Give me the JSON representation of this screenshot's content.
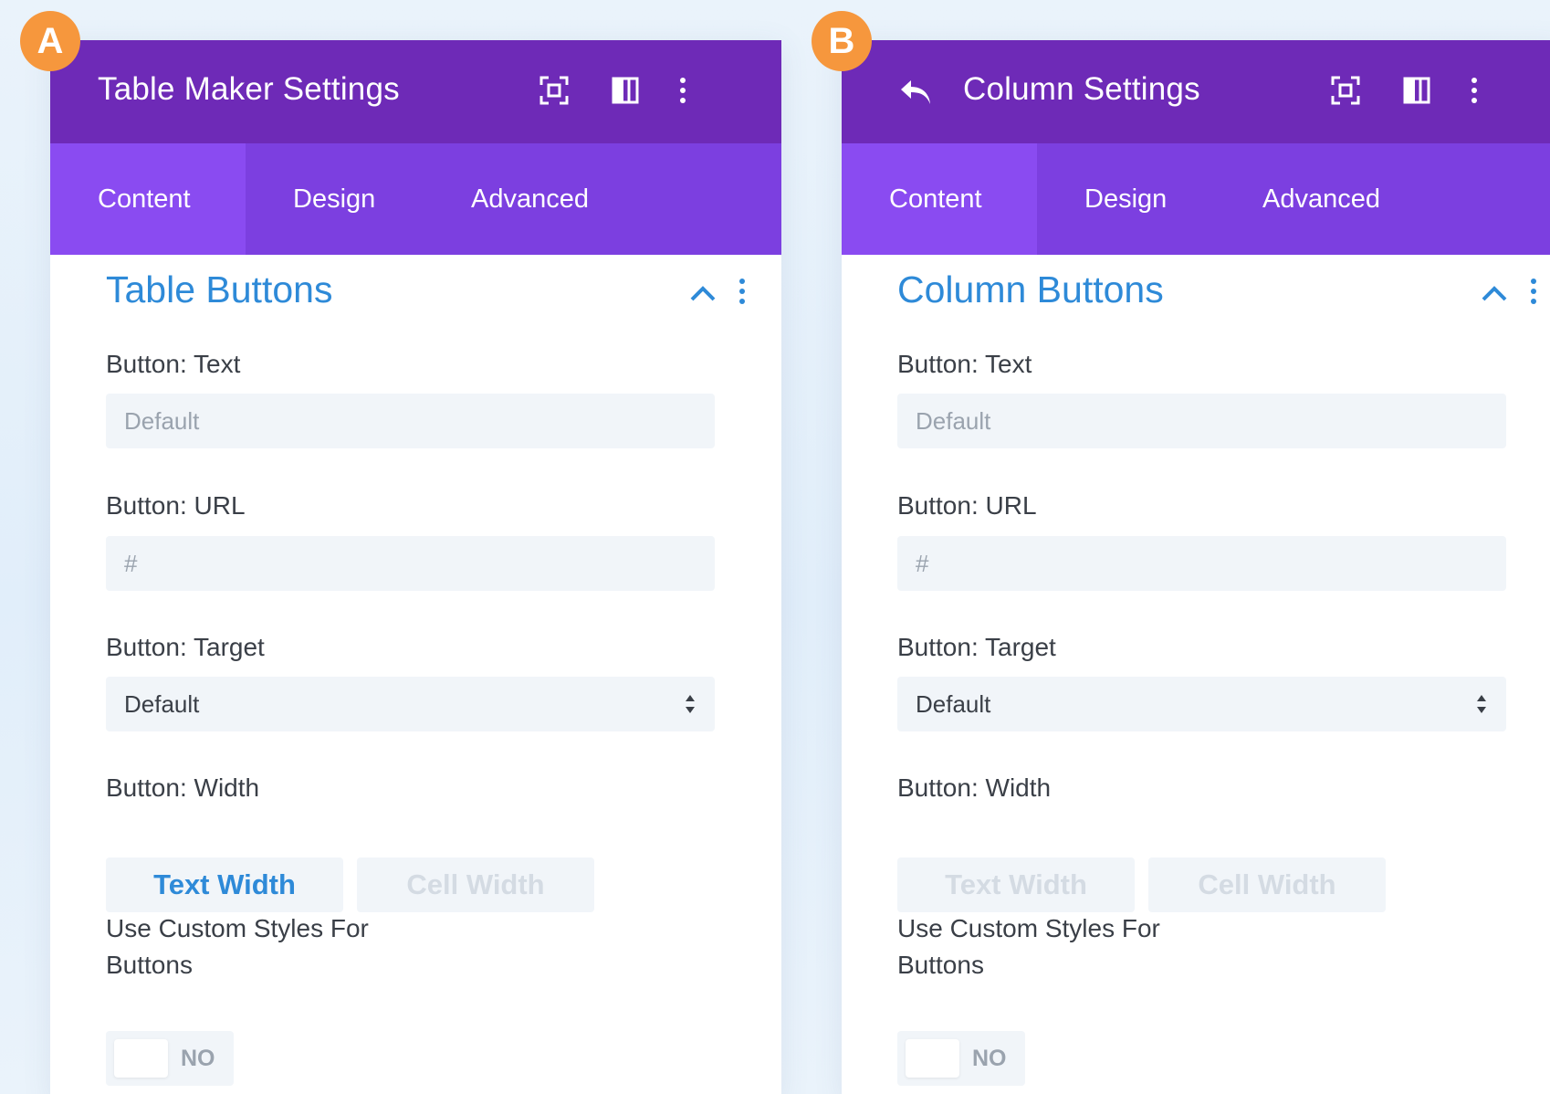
{
  "colors": {
    "badge": "#f6973d",
    "header_bg": "#6e2ab7",
    "tabs_bg": "#7c3fe0",
    "active_tab_bg": "#8a4bf1",
    "accent_blue": "#2e8ad8"
  },
  "panels": [
    {
      "badge": "A",
      "has_back_icon": false,
      "title": "Table Maker Settings",
      "header_icons": [
        "focus-icon",
        "split-view-icon",
        "more-vertical-icon"
      ],
      "tabs": [
        {
          "label": "Content",
          "active": true
        },
        {
          "label": "Design",
          "active": false
        },
        {
          "label": "Advanced",
          "active": false
        }
      ],
      "section": {
        "title": "Table Buttons",
        "icons": [
          "chevron-up-icon",
          "more-vertical-icon"
        ]
      },
      "fields": {
        "text": {
          "label": "Button: Text",
          "placeholder": "Default"
        },
        "url": {
          "label": "Button: URL",
          "placeholder": "#"
        },
        "target": {
          "label": "Button: Target",
          "value": "Default"
        },
        "width": {
          "label": "Button: Width",
          "options": [
            {
              "label": "Text Width",
              "selected": true
            },
            {
              "label": "Cell Width",
              "selected": false
            }
          ]
        },
        "custom_styles": {
          "label_line1": "Use Custom Styles For",
          "label_line2": "Buttons",
          "toggle": "NO"
        }
      }
    },
    {
      "badge": "B",
      "has_back_icon": true,
      "title": "Column Settings",
      "header_icons": [
        "undo-icon",
        "focus-icon",
        "split-view-icon",
        "more-vertical-icon"
      ],
      "tabs": [
        {
          "label": "Content",
          "active": true
        },
        {
          "label": "Design",
          "active": false
        },
        {
          "label": "Advanced",
          "active": false
        }
      ],
      "section": {
        "title": "Column Buttons",
        "icons": [
          "chevron-up-icon",
          "more-vertical-icon"
        ]
      },
      "fields": {
        "text": {
          "label": "Button: Text",
          "placeholder": "Default"
        },
        "url": {
          "label": "Button: URL",
          "placeholder": "#"
        },
        "target": {
          "label": "Button: Target",
          "value": "Default"
        },
        "width": {
          "label": "Button: Width",
          "options": [
            {
              "label": "Text Width",
              "selected": false
            },
            {
              "label": "Cell Width",
              "selected": false
            }
          ]
        },
        "custom_styles": {
          "label_line1": "Use Custom Styles For",
          "label_line2": "Buttons",
          "toggle": "NO"
        }
      }
    }
  ]
}
